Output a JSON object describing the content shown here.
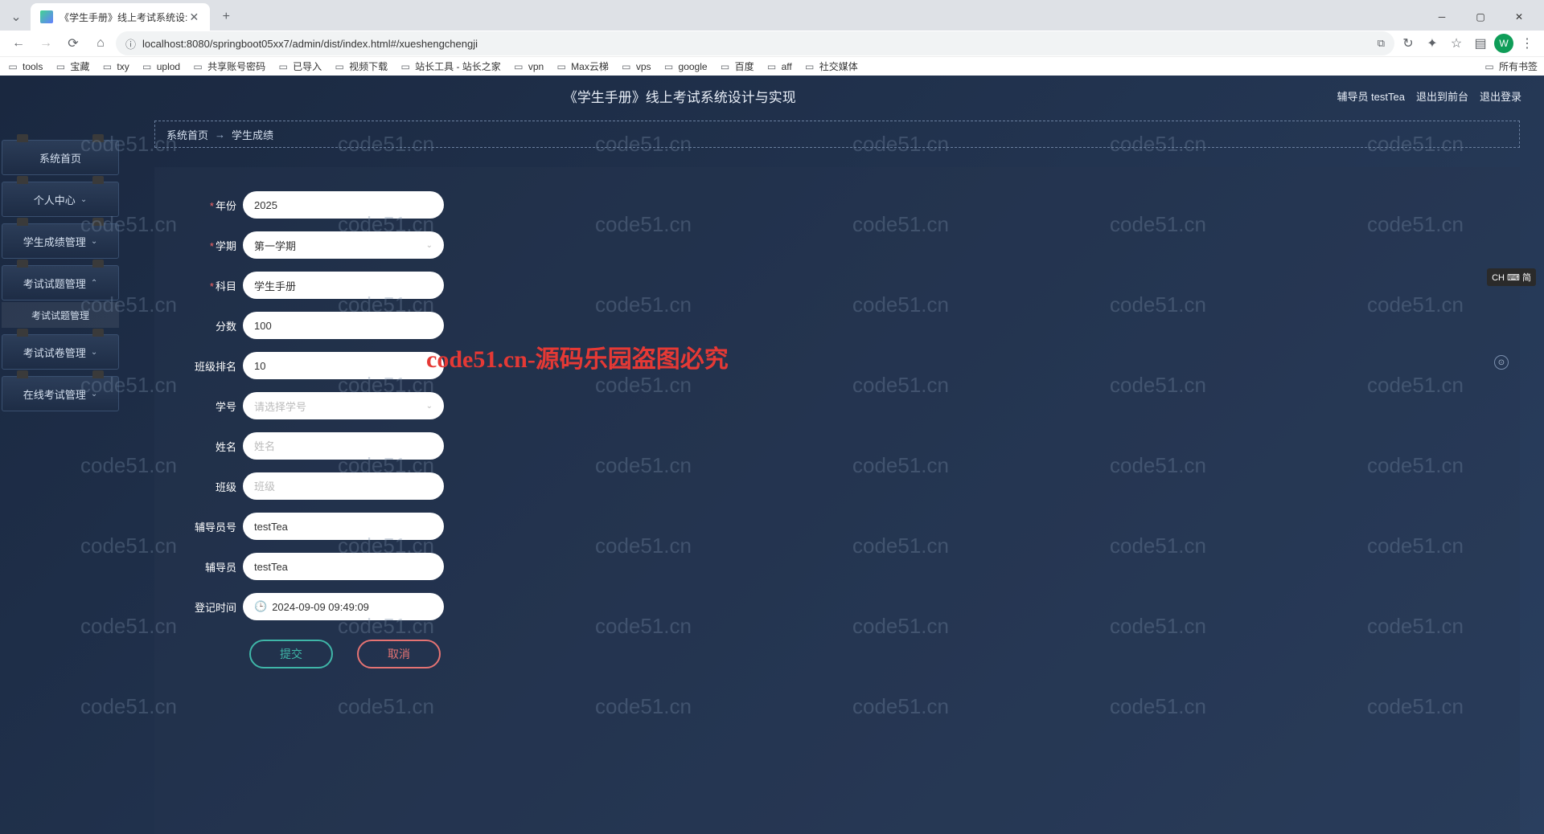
{
  "browser": {
    "tab_title": "《学生手册》线上考试系统设:",
    "url": "localhost:8080/springboot05xx7/admin/dist/index.html#/xueshengchengji",
    "avatar_letter": "W",
    "all_bookmarks": "所有书签"
  },
  "bookmarks": [
    "tools",
    "宝藏",
    "txy",
    "uplod",
    "共享账号密码",
    "已导入",
    "视频下载",
    "站长工具 - 站长之家",
    "vpn",
    "Max云梯",
    "vps",
    "google",
    "百度",
    "aff",
    "社交媒体"
  ],
  "app_title": "《学生手册》线上考试系统设计与实现",
  "header": {
    "role_user": "辅导员 testTea",
    "logout_front": "退出到前台",
    "logout": "退出登录"
  },
  "sidebar": {
    "home": "系统首页",
    "user_center": "个人中心",
    "grade_mgmt": "学生成绩管理",
    "question_mgmt": "考试试题管理",
    "question_sub": "考试试题管理",
    "paper_mgmt": "考试试卷管理",
    "online_exam": "在线考试管理"
  },
  "breadcrumb": {
    "home": "系统首页",
    "current": "学生成绩"
  },
  "form": {
    "year": {
      "label": "年份",
      "value": "2025"
    },
    "semester": {
      "label": "学期",
      "value": "第一学期"
    },
    "subject": {
      "label": "科目",
      "value": "学生手册"
    },
    "score": {
      "label": "分数",
      "value": "100"
    },
    "rank": {
      "label": "班级排名",
      "value": "10"
    },
    "student_no": {
      "label": "学号",
      "placeholder": "请选择学号"
    },
    "name": {
      "label": "姓名",
      "placeholder": "姓名"
    },
    "class": {
      "label": "班级",
      "placeholder": "班级"
    },
    "advisor_no": {
      "label": "辅导员号",
      "value": "testTea"
    },
    "advisor": {
      "label": "辅导员",
      "value": "testTea"
    },
    "reg_time": {
      "label": "登记时间",
      "value": "2024-09-09 09:49:09"
    }
  },
  "buttons": {
    "submit": "提交",
    "cancel": "取消"
  },
  "ime": "CH ⌨ 简",
  "watermark_small": "code51.cn",
  "watermark_red": "code51.cn-源码乐园盗图必究"
}
